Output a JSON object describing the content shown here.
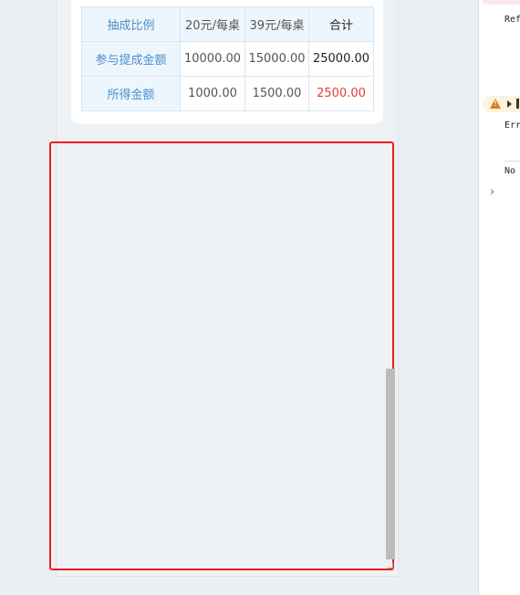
{
  "commission_table": {
    "header": [
      "抽成比例",
      "20元/每桌",
      "39元/每桌",
      "合计"
    ],
    "rows": [
      {
        "label": "参与提成金额",
        "values": [
          "10000.00",
          "15000.00",
          "25000.00"
        ]
      },
      {
        "label": "所得金额",
        "values": [
          "1000.00",
          "1500.00",
          "2500.00"
        ]
      }
    ]
  },
  "devtools": {
    "line1": "Ref",
    "line2": "Err",
    "line3": "No",
    "prompt": "›"
  },
  "colors": {
    "highlight": "#f01d1d",
    "total_red": "#e53b3b",
    "header_blue": "#4a8fc9"
  }
}
